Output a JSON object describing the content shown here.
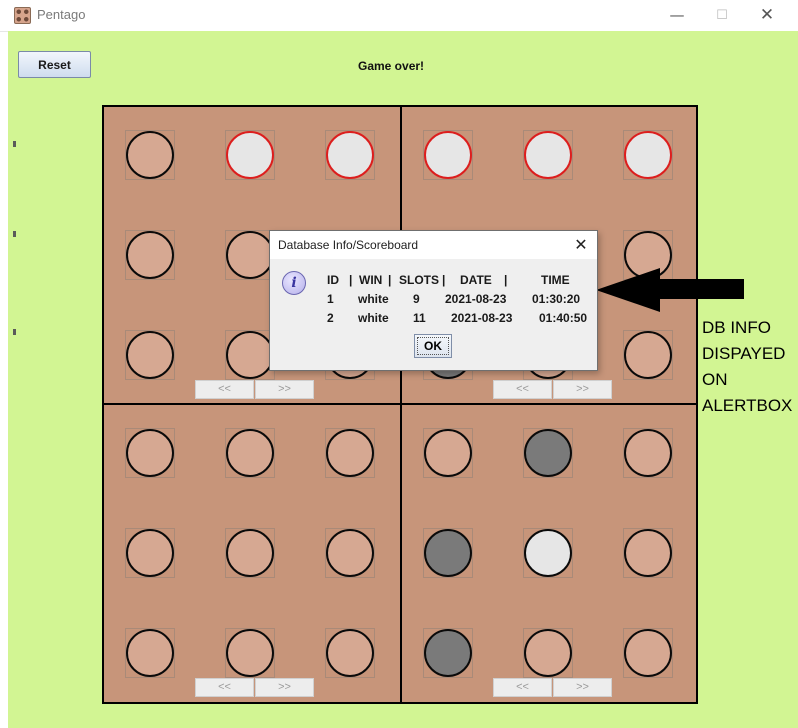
{
  "window": {
    "title": "Pentago",
    "app_icon": "pentago-board-icon",
    "controls": {
      "minimize": "—",
      "maximize": "☐",
      "close": "✕"
    }
  },
  "toolbar": {
    "reset_label": "Reset",
    "status": "Game over!"
  },
  "board": {
    "rotate_left_label": "<<",
    "rotate_right_label": ">>",
    "colors": {
      "background": "#c7957a",
      "empty": "#d6a892",
      "white": "#e6e6e6",
      "grey": "#7a7a7a",
      "win_outline": "#dc1e1e"
    },
    "quadrants": [
      {
        "name": "top-left",
        "cells": [
          [
            "empty",
            "white-win",
            "white-win"
          ],
          [
            "empty",
            "empty",
            "empty"
          ],
          [
            "empty",
            "empty",
            "empty"
          ]
        ]
      },
      {
        "name": "top-right",
        "cells": [
          [
            "white-win",
            "white-win",
            "white-win"
          ],
          [
            "empty",
            "empty",
            "empty"
          ],
          [
            "grey",
            "empty",
            "empty"
          ]
        ]
      },
      {
        "name": "bottom-left",
        "cells": [
          [
            "empty",
            "empty",
            "empty"
          ],
          [
            "empty",
            "empty",
            "empty"
          ],
          [
            "empty",
            "empty",
            "empty"
          ]
        ]
      },
      {
        "name": "bottom-right",
        "cells": [
          [
            "empty",
            "grey",
            "empty"
          ],
          [
            "grey",
            "white",
            "empty"
          ],
          [
            "grey",
            "empty",
            "empty"
          ]
        ]
      }
    ]
  },
  "dialog": {
    "title": "Database Info/Scoreboard",
    "close_glyph": "✕",
    "icon": "information-icon",
    "icon_glyph": "i",
    "columns": [
      "ID",
      "|",
      "WIN",
      "|",
      "SLOTS",
      "|",
      "DATE",
      "|",
      "TIME"
    ],
    "rows": [
      {
        "id": "1",
        "win": "white",
        "slots": "9",
        "date": "2021-08-23",
        "time": "01:30:20"
      },
      {
        "id": "2",
        "win": "white",
        "slots": "11",
        "date": "2021-08-23",
        "time": "01:40:50"
      }
    ],
    "ok_label": "OK"
  },
  "annotation": {
    "arrow": "left-arrow",
    "lines": [
      "DB INFO",
      "DISPAYED",
      "ON",
      "ALERTBOX"
    ]
  }
}
